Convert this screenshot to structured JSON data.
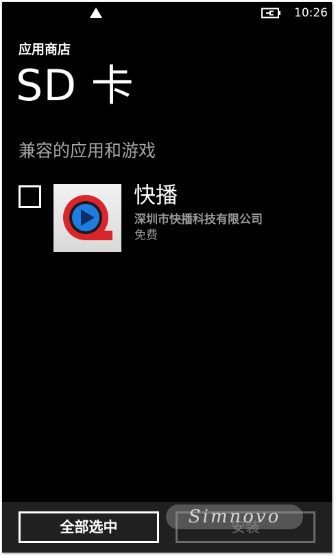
{
  "status_bar": {
    "time": "10:26",
    "signal_icon": "signal-triangle-icon",
    "battery_icon": "battery-charging-icon"
  },
  "header": {
    "app_title": "应用商店",
    "page_title": "SD 卡"
  },
  "section": {
    "title": "兼容的应用和游戏"
  },
  "apps": [
    {
      "name": "快播",
      "publisher": "深圳市快播科技有限公司",
      "price": "免费",
      "checked": false,
      "icon": "qvod-player-icon"
    }
  ],
  "app_bar": {
    "select_all_label": "全部选中",
    "install_label": "安装"
  },
  "watermark": "Simnovo",
  "colors": {
    "background": "#000000",
    "app_bar": "#202020",
    "secondary_text": "#a6a6a6",
    "disabled": "#6b6b6b",
    "icon_red": "#d8262b",
    "icon_blue": "#1e7de0"
  }
}
